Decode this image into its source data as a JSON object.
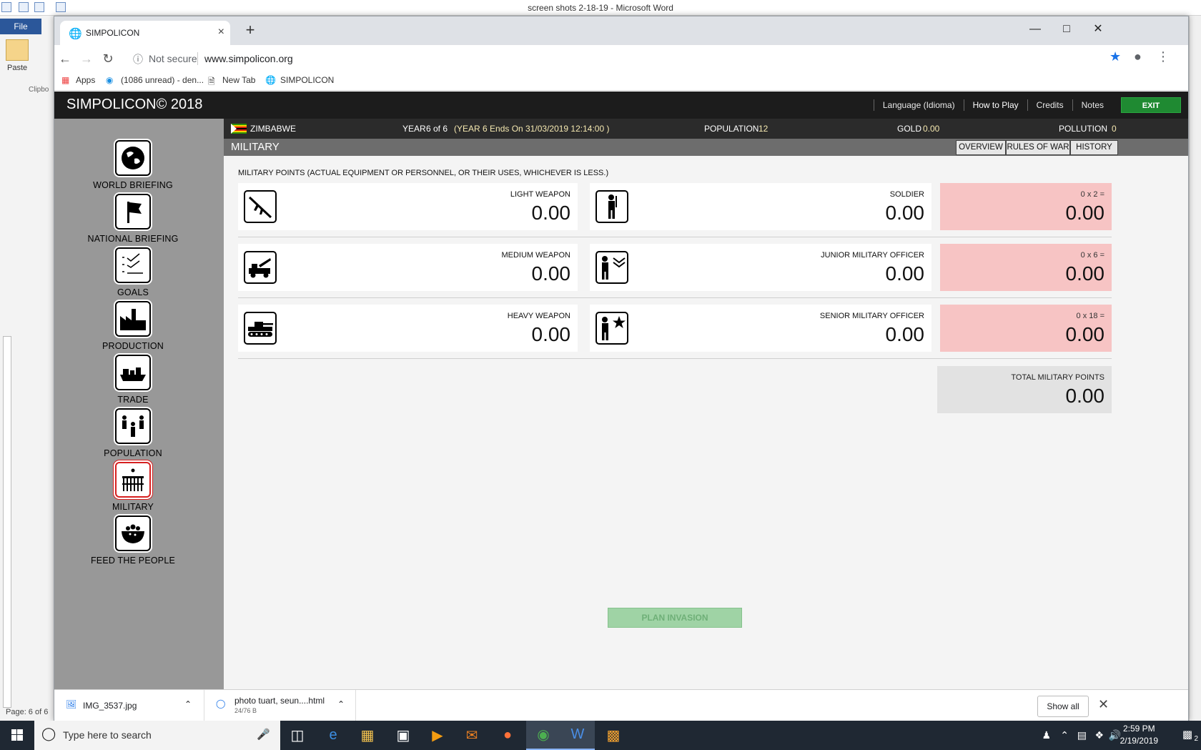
{
  "word": {
    "title": "screen shots 2-18-19 - Microsoft Word",
    "file_tab": "File",
    "paste_label": "Paste",
    "clipboard_label": "Clipbo",
    "status_page": "Page: 6 of 6"
  },
  "browser": {
    "tab_title": "SIMPOLICON",
    "not_secure": "Not secure",
    "url": "www.simpolicon.org",
    "bookmarks": [
      {
        "label": "Apps"
      },
      {
        "label": "(1086 unread) - den..."
      },
      {
        "label": "New Tab"
      },
      {
        "label": "SIMPOLICON"
      }
    ]
  },
  "game": {
    "logo": "SIMPOLICON© 2018",
    "menu": {
      "language": "Language (Idioma)",
      "how_to_play": "How to Play",
      "credits": "Credits",
      "notes": "Notes",
      "exit": "EXIT"
    },
    "sidebar": [
      {
        "label": "WORLD BRIEFING",
        "icon": "globe-icon"
      },
      {
        "label": "NATIONAL BRIEFING",
        "icon": "flag-icon"
      },
      {
        "label": "GOALS",
        "icon": "checklist-icon"
      },
      {
        "label": "PRODUCTION",
        "icon": "factory-icon"
      },
      {
        "label": "TRADE",
        "icon": "ship-icon"
      },
      {
        "label": "POPULATION",
        "icon": "people-icon"
      },
      {
        "label": "MILITARY",
        "icon": "army-icon",
        "active": true
      },
      {
        "label": "FEED THE PEOPLE",
        "icon": "food-bowl-icon"
      }
    ],
    "info": {
      "country": "ZIMBABWE",
      "year_label": "YEAR",
      "year_value": "6 of 6",
      "year_end": "(YEAR 6 Ends On 31/03/2019 12:14:00 )",
      "population_label": "POPULATION",
      "population_value": "12",
      "gold_label": "GOLD",
      "gold_value": "0.00",
      "pollution_label": "POLLUTION",
      "pollution_value": "0"
    },
    "section_title": "MILITARY",
    "tabs": {
      "overview": "OVERVIEW",
      "rules": "RULES OF WAR",
      "history": "HISTORY"
    },
    "note": "MILITARY POINTS  (ACTUAL EQUIPMENT OR PERSONNEL, OR THEIR USES, WHICHEVER IS LESS.)",
    "rows": [
      {
        "weapon": "LIGHT WEAPON",
        "weapon_value": "0.00",
        "person": "SOLDIER",
        "person_value": "0.00",
        "multiplier": "0 x 2 =",
        "points": "0.00"
      },
      {
        "weapon": "MEDIUM WEAPON",
        "weapon_value": "0.00",
        "person": "JUNIOR MILITARY OFFICER",
        "person_value": "0.00",
        "multiplier": "0 x 6 =",
        "points": "0.00"
      },
      {
        "weapon": "HEAVY WEAPON",
        "weapon_value": "0.00",
        "person": "SENIOR MILITARY OFFICER",
        "person_value": "0.00",
        "multiplier": "0 x 18 =",
        "points": "0.00"
      }
    ],
    "total_label": "TOTAL MILITARY POINTS",
    "total_value": "0.00",
    "plan_invasion": "PLAN INVASION"
  },
  "downloads": [
    {
      "name": "IMG_3537.jpg",
      "sub": ""
    },
    {
      "name": "photo tuart, seun....html",
      "sub": "24/76 B"
    }
  ],
  "downloads_show_all": "Show all",
  "taskbar": {
    "search_placeholder": "Type here to search",
    "time": "2:59 PM",
    "date": "2/19/2019",
    "notifications": "2"
  }
}
